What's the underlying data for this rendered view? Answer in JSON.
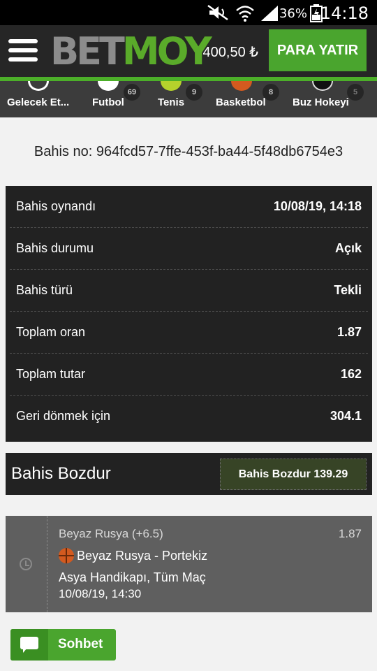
{
  "status_bar": {
    "battery": "36%",
    "time": "14:18"
  },
  "header": {
    "logo_bet": "BET",
    "logo_moy": "MOY",
    "balance": "400,50 ₺",
    "deposit_label": "PARA YATIR"
  },
  "sports": [
    {
      "label": "Gelecek Et...",
      "count": ""
    },
    {
      "label": "Futbol",
      "count": "69"
    },
    {
      "label": "Tenis",
      "count": "9"
    },
    {
      "label": "Basketbol",
      "count": "8"
    },
    {
      "label": "Buz Hokeyi",
      "count": "5"
    }
  ],
  "bet_no": "Bahis no: 964fcd57-7ffe-453f-ba44-5f48db6754e3",
  "details": [
    {
      "key": "Bahis oynandı",
      "value": "10/08/19, 14:18"
    },
    {
      "key": "Bahis durumu",
      "value": "Açık"
    },
    {
      "key": "Bahis türü",
      "value": "Tekli"
    },
    {
      "key": "Toplam oran",
      "value": "1.87"
    },
    {
      "key": "Toplam tutar",
      "value": "162"
    },
    {
      "key": "Geri dönmek için",
      "value": "304.1"
    }
  ],
  "cashout": {
    "title": "Bahis Bozdur",
    "button": "Bahis Bozdur 139.29"
  },
  "selection": {
    "pick": "Beyaz Rusya (+6.5)",
    "odd": "1.87",
    "match": "Beyaz Rusya - Portekiz",
    "market": "Asya Handikapı, Tüm Maç",
    "date": "10/08/19, 14:30"
  },
  "chat": {
    "label": "Sohbet"
  }
}
